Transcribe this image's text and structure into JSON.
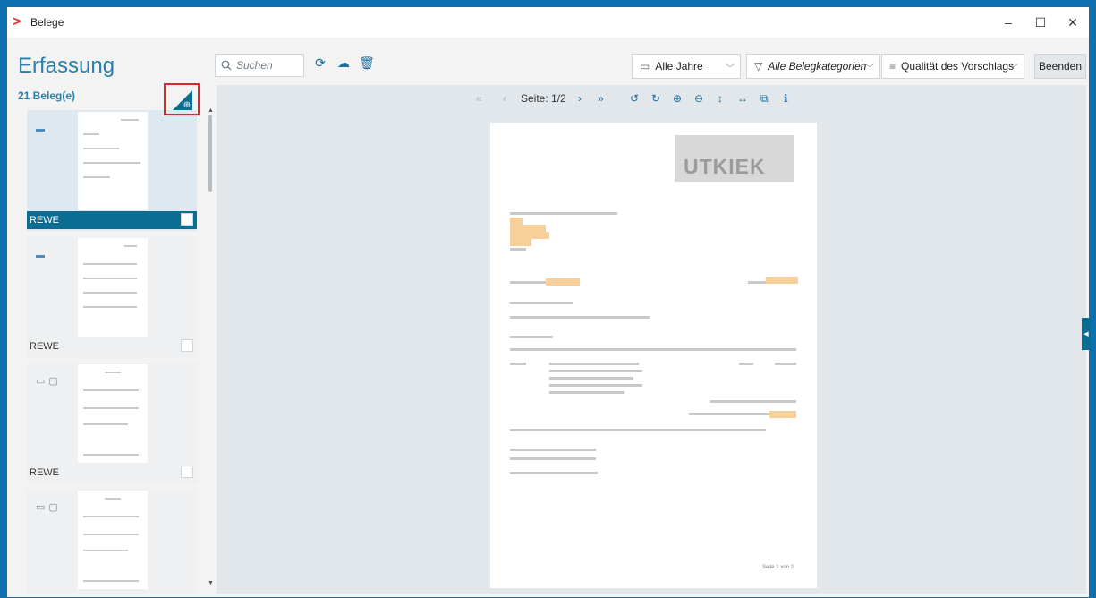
{
  "window": {
    "title": "Belege",
    "controls": {
      "minimize": "–",
      "maximize": "☐",
      "close": "✕"
    }
  },
  "header": {
    "page_title": "Erfassung",
    "search": {
      "placeholder": "Suchen"
    },
    "filters": {
      "years": "Alle Jahre",
      "categories": "Alle Belegkategorien",
      "sort": "Qualität des Vorschlags"
    },
    "end_button": "Beenden"
  },
  "list": {
    "count_label": "21 Beleg(e)",
    "items": [
      {
        "label": "REWE",
        "selected": true,
        "icon": "scan-icon"
      },
      {
        "label": "REWE",
        "selected": false,
        "icon": "scan-icon"
      },
      {
        "label": "REWE",
        "selected": false,
        "icon": "scan-comment-icon"
      },
      {
        "label": "",
        "selected": false,
        "icon": "scan-comment-icon"
      }
    ]
  },
  "viewer": {
    "page_indicator": "Seite: 1/2",
    "doc_logo_text": "UTKIEK",
    "doc_footer": "Seite 1 von 2"
  },
  "colors": {
    "accent": "#0c6d93",
    "title_blue": "#2a7fa8",
    "highlight": "#f6cf9b",
    "frame": "#0e6fae",
    "marker_red": "#d9272e"
  }
}
